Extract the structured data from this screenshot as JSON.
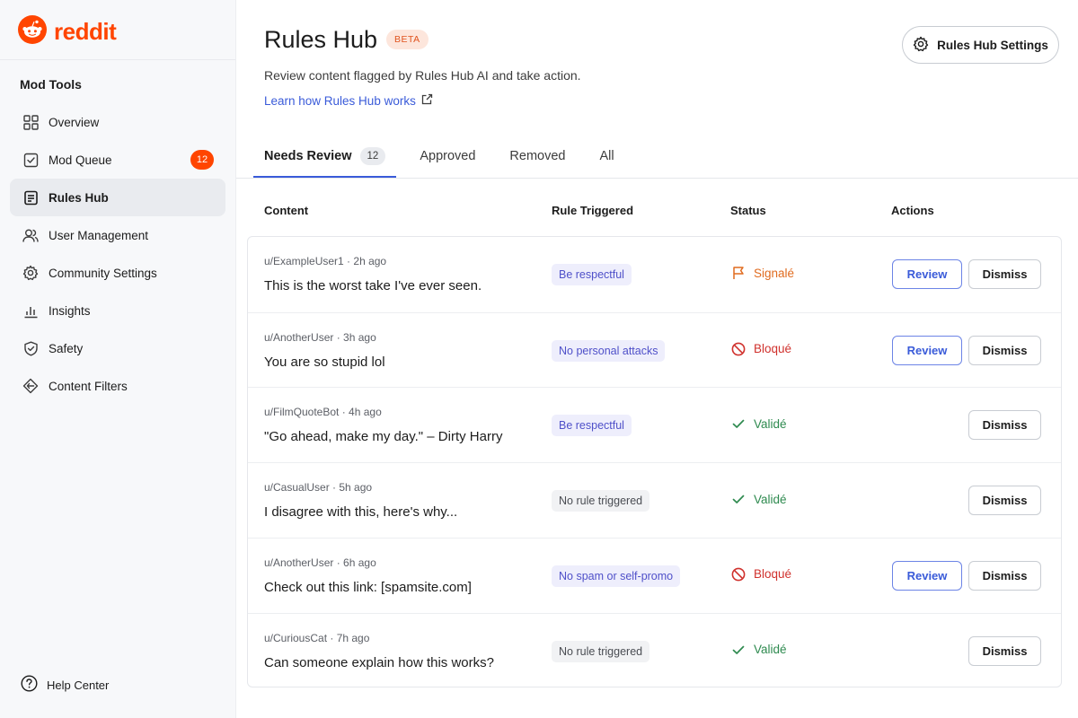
{
  "brand": {
    "name": "reddit",
    "color": "#ff4500"
  },
  "sidebar": {
    "section_title": "Mod Tools",
    "items": [
      {
        "label": "Overview",
        "icon": "overview-grid-icon"
      },
      {
        "label": "Mod Queue",
        "icon": "queue-icon",
        "badge": "12"
      },
      {
        "label": "Rules Hub",
        "icon": "rules-icon",
        "active": true
      },
      {
        "label": "User Management",
        "icon": "users-icon"
      },
      {
        "label": "Community Settings",
        "icon": "gear-icon"
      },
      {
        "label": "Insights",
        "icon": "chart-icon"
      },
      {
        "label": "Safety",
        "icon": "shield-icon"
      },
      {
        "label": "Content Filters",
        "icon": "filter-icon"
      }
    ],
    "help_label": "Help Center"
  },
  "header": {
    "title": "Rules Hub",
    "badge": "BETA",
    "description": "Review content flagged by Rules Hub AI and take action.",
    "learn_link": "Learn how Rules Hub works",
    "settings_label": "Rules Hub Settings"
  },
  "tabs": [
    {
      "label": "Needs Review",
      "count": "12",
      "active": true
    },
    {
      "label": "Approved"
    },
    {
      "label": "Removed"
    },
    {
      "label": "All"
    }
  ],
  "table": {
    "columns": [
      "Content",
      "Rule Triggered",
      "Status",
      "Actions"
    ],
    "review_label": "Review",
    "dismiss_label": "Dismiss",
    "rows": [
      {
        "user": "u/ExampleUser1",
        "time": "2h ago",
        "text": "This is the worst take I've ever seen.",
        "rule": "Be respectful",
        "rule_style": "violet",
        "status": "Signalé",
        "status_type": "flagged",
        "status_color": "#e06b1f",
        "review": true
      },
      {
        "user": "u/AnotherUser",
        "time": "3h ago",
        "text": "You are so stupid lol",
        "rule": "No personal attacks",
        "rule_style": "violet",
        "status": "Bloqué",
        "status_type": "blocked",
        "status_color": "#d0312d",
        "review": true
      },
      {
        "user": "u/FilmQuoteBot",
        "time": "4h ago",
        "text": "\"Go ahead, make my day.\" – Dirty Harry",
        "rule": "Be respectful",
        "rule_style": "violet",
        "status": "Validé",
        "status_type": "valid",
        "status_color": "#2e8a4f",
        "review": false
      },
      {
        "user": "u/CasualUser",
        "time": "5h ago",
        "text": "I disagree with this, here's why...",
        "rule": "No rule triggered",
        "rule_style": "gray",
        "status": "Validé",
        "status_type": "valid",
        "status_color": "#2e8a4f",
        "review": false
      },
      {
        "user": "u/AnotherUser",
        "time": "6h ago",
        "text": "Check out this link: [spamsite.com]",
        "rule": "No spam or self-promo",
        "rule_style": "violet",
        "status": "Bloqué",
        "status_type": "blocked",
        "status_color": "#d0312d",
        "review": true
      },
      {
        "user": "u/CuriousCat",
        "time": "7h ago",
        "text": "Can someone explain how this works?",
        "rule": "No rule triggered",
        "rule_style": "gray",
        "status": "Validé",
        "status_type": "valid",
        "status_color": "#2e8a4f",
        "review": false
      }
    ]
  }
}
